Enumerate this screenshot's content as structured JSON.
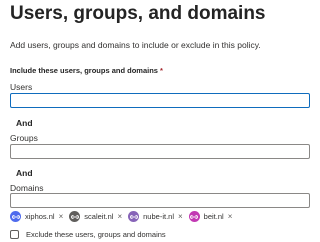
{
  "page": {
    "title": "Users, groups, and domains",
    "description": "Add users, groups and domains to include or exclude in this policy."
  },
  "include_section": {
    "heading": "Include these users, groups and domains",
    "required_marker": "*"
  },
  "users_field": {
    "label": "Users",
    "value": "",
    "focused": true
  },
  "and_1": "And",
  "groups_field": {
    "label": "Groups",
    "value": ""
  },
  "and_2": "And",
  "domains_field": {
    "label": "Domains",
    "value": ""
  },
  "domain_tags": [
    {
      "label": "xiphos.nl",
      "icon": "link-icon",
      "color": "#4f6bed"
    },
    {
      "label": "scaleit.nl",
      "icon": "link-icon",
      "color": "#605e5c"
    },
    {
      "label": "nube-it.nl",
      "icon": "link-icon",
      "color": "#8764b8"
    },
    {
      "label": "beit.nl",
      "icon": "link-icon",
      "color": "#c239b3"
    }
  ],
  "remove_glyph": "×",
  "exclude_checkbox": {
    "label": "Exclude these users, groups and domains",
    "checked": false
  },
  "colors": {
    "focus_border": "#0f6cbd",
    "required": "#a4262c",
    "border": "#8a8886"
  }
}
